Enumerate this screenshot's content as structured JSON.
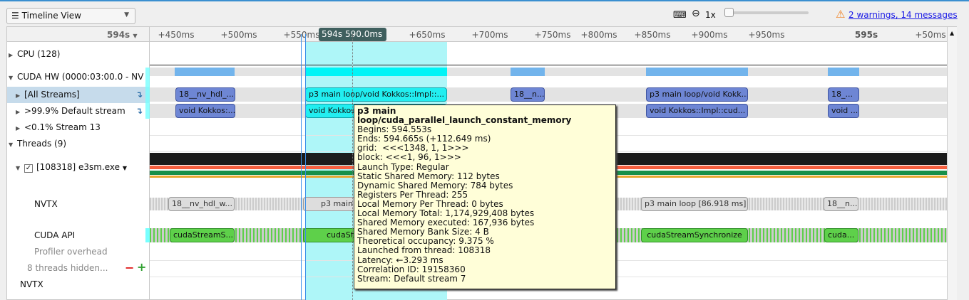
{
  "toolbar": {
    "view": "Timeline View",
    "zoom": "1x",
    "zoom_level": 0,
    "warnings": "2 warnings, 14 messages",
    "keyboard_icon": "⌨",
    "zoom_icon": "🔍",
    "warning_icon": "⚠"
  },
  "ruler": {
    "base": "594s",
    "ticks": [
      "+450ms",
      "+500ms",
      "+550ms",
      "+650ms",
      "+700ms",
      "+750ms",
      "+800ms",
      "+850ms",
      "+900ms",
      "+950ms",
      "595s",
      "+50ms"
    ],
    "cursor": "594s 590.0ms"
  },
  "tree": {
    "cpu": "CPU (128)",
    "cuda_hw": "CUDA HW (0000:03:00.0 - NV",
    "all_streams": "[All Streams]",
    "default_stream": ">99.9% Default stream",
    "stream13": "<0.1% Stream 13",
    "threads": "Threads (9)",
    "process": "[108318] e3sm.exe",
    "nvtx": "NVTX",
    "cuda_api": "CUDA API",
    "profiler": "Profiler overhead",
    "hidden": "8 threads hidden...",
    "nvtx2": "NVTX"
  },
  "bars": {
    "streams": [
      "18__nv_hdl_...",
      "p3 main loop/void Kokkos::Impl::...",
      "18__n...",
      "p3 main loop/void Kokk...",
      "18_..."
    ],
    "default": [
      "void Kokkos:...",
      "void Kokkos...",
      "void Kokkos::Impl::cud...",
      "void ..."
    ],
    "nvtx": [
      "18__nv_hdl_w...",
      "p3 main",
      "p3 main loop [86.918 ms]",
      "18__n..."
    ],
    "api": [
      "cudaStreamS...",
      "cudaSt",
      "cudaStreamSynchronize",
      "cuda..."
    ]
  },
  "tooltip": {
    "title": "p3 main loop/cuda_parallel_launch_constant_memory",
    "lines": [
      "Begins: 594.553s",
      "Ends: 594.665s (+112.649 ms)",
      "grid:  <<<1348, 1, 1>>>",
      "block: <<<1, 96, 1>>>",
      "Launch Type: Regular",
      "Static Shared Memory: 112 bytes",
      "Dynamic Shared Memory: 784 bytes",
      "Registers Per Thread: 255",
      "Local Memory Per Thread: 0 bytes",
      "Local Memory Total: 1,174,929,408 bytes",
      "Shared Memory executed: 167,936 bytes",
      "Shared Memory Bank Size: 4 B",
      "Theoretical occupancy: 9.375 %",
      "Launched from thread: 108318",
      "Latency: ←3.293 ms",
      "Correlation ID: 19158360",
      "Stream: Default stream 7"
    ]
  }
}
